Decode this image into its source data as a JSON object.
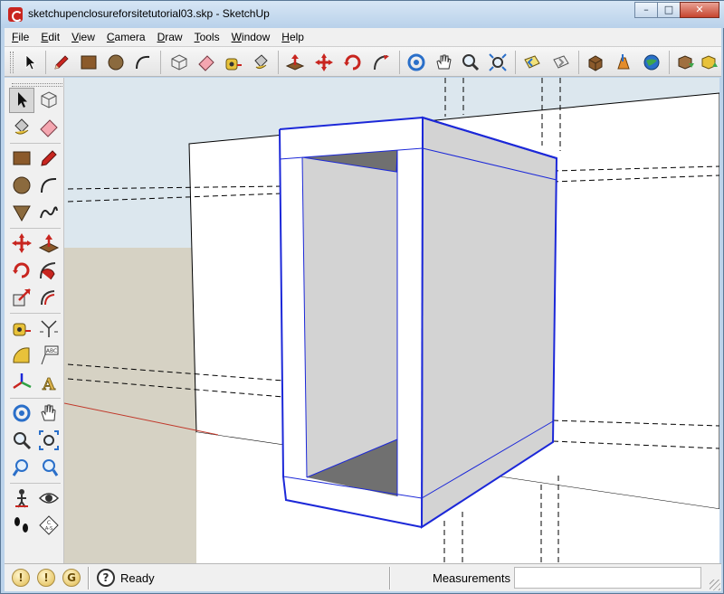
{
  "window": {
    "title": "sketchupenclosureforsitetutorial03.skp - SketchUp",
    "controls": {
      "minimize": "–",
      "maximize": "□",
      "close": "✕"
    }
  },
  "menu": [
    "File",
    "Edit",
    "View",
    "Camera",
    "Draw",
    "Tools",
    "Window",
    "Help"
  ],
  "toolbar_icons": [
    "select-icon",
    "pencil-icon",
    "rectangle-icon",
    "circle-icon",
    "arc-icon",
    "make-component-icon",
    "eraser-icon",
    "tape-measure-icon",
    "paint-bucket-icon",
    "push-pull-icon",
    "move-icon",
    "rotate-icon",
    "follow-me-icon",
    "orbit-icon",
    "pan-icon",
    "zoom-icon",
    "zoom-extents-icon",
    "previous-view-icon",
    "next-view-icon",
    "3d-warehouse-icon",
    "share-model-icon",
    "google-earth-icon",
    "get-models-icon",
    "share-component-icon"
  ],
  "left_toolbar_icons": [
    "select-icon",
    "make-component-icon",
    "paint-bucket-icon",
    "eraser-icon",
    "rectangle-icon",
    "pencil-icon",
    "circle-icon",
    "arc-icon",
    "polygon-icon",
    "freehand-icon",
    "move-icon",
    "push-pull-icon",
    "rotate-icon",
    "follow-me-icon",
    "scale-icon",
    "offset-icon",
    "tape-measure-icon",
    "dimension-icon",
    "protractor-icon",
    "text-icon",
    "axes-icon",
    "3d-text-icon",
    "orbit-icon",
    "pan-icon",
    "zoom-icon",
    "zoom-window-icon",
    "previous-icon",
    "zoom-extents-icon",
    "position-camera-icon",
    "look-around-icon",
    "walk-icon",
    "section-plane-icon"
  ],
  "status": {
    "icons": [
      "geo-location-icon",
      "credits-icon",
      "google-sign-in-icon"
    ],
    "icon_glyphs": [
      "!",
      "!",
      "G"
    ],
    "help": "?",
    "text": "Ready",
    "measurements_label": "Measurements",
    "measurements_value": ""
  },
  "colors": {
    "selection_blue": "#1c28d8",
    "ground": "#d6d2c4",
    "sky": "#dce7ee",
    "face_gray": "#d3d3d3",
    "shadow_gray": "#707070",
    "red_axis": "#c0392b",
    "sketchup_red": "#c8251f"
  }
}
